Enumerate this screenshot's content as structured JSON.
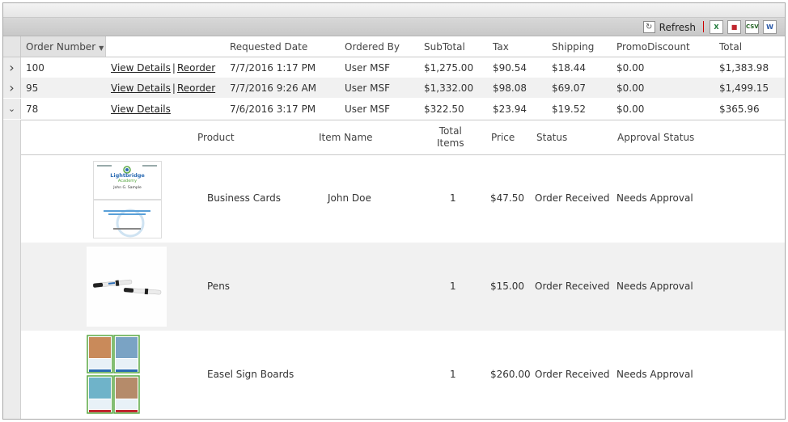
{
  "toolbar": {
    "refresh_label": "Refresh"
  },
  "columns": [
    "Order Number",
    "Requested Date",
    "Ordered By",
    "SubTotal",
    "Tax",
    "Shipping",
    "PromoDiscount",
    "Total"
  ],
  "orders": [
    {
      "expander": ">",
      "number": "100",
      "view_details": "View Details",
      "sep": "|",
      "reorder": "Reorder",
      "date": "7/7/2016 1:17 PM",
      "ordered_by": "User MSF",
      "subtotal": "$1,275.00",
      "tax": "$90.54",
      "shipping": "$18.44",
      "promo": "$0.00",
      "total": "$1,383.98"
    },
    {
      "expander": ">",
      "number": "95",
      "view_details": "View Details",
      "sep": "|",
      "reorder": "Reorder",
      "date": "7/7/2016 9:26 AM",
      "ordered_by": "User MSF",
      "subtotal": "$1,332.00",
      "tax": "$98.08",
      "shipping": "$69.07",
      "promo": "$0.00",
      "total": "$1,499.15"
    },
    {
      "expander": "v",
      "number": "78",
      "view_details": "View Details",
      "date": "7/6/2016 3:17 PM",
      "ordered_by": "User MSF",
      "subtotal": "$322.50",
      "tax": "$23.94",
      "shipping": "$19.52",
      "promo": "$0.00",
      "total": "$365.96"
    }
  ],
  "detail": {
    "columns": {
      "product": "Product",
      "item_name": "Item Name",
      "total_items_1": "Total",
      "total_items_2": "Items",
      "price": "Price",
      "status": "Status",
      "approval": "Approval Status"
    },
    "items": [
      {
        "product": "Business Cards",
        "item_name": "John Doe",
        "total_items": "1",
        "price": "$47.50",
        "status": "Order Received",
        "approval": "Needs Approval",
        "thumb_brand": "Lightbridge",
        "thumb_brand2": "Academy",
        "thumb_person": "John G. Sample"
      },
      {
        "product": "Pens",
        "item_name": "",
        "total_items": "1",
        "price": "$15.00",
        "status": "Order Received",
        "approval": "Needs Approval"
      },
      {
        "product": "Easel Sign Boards",
        "item_name": "",
        "total_items": "1",
        "price": "$260.00",
        "status": "Order Received",
        "approval": "Needs Approval"
      }
    ]
  },
  "colors": {
    "accent_red": "#c0262e",
    "brand_green": "#5aa844",
    "brand_blue": "#2a6bb3"
  }
}
